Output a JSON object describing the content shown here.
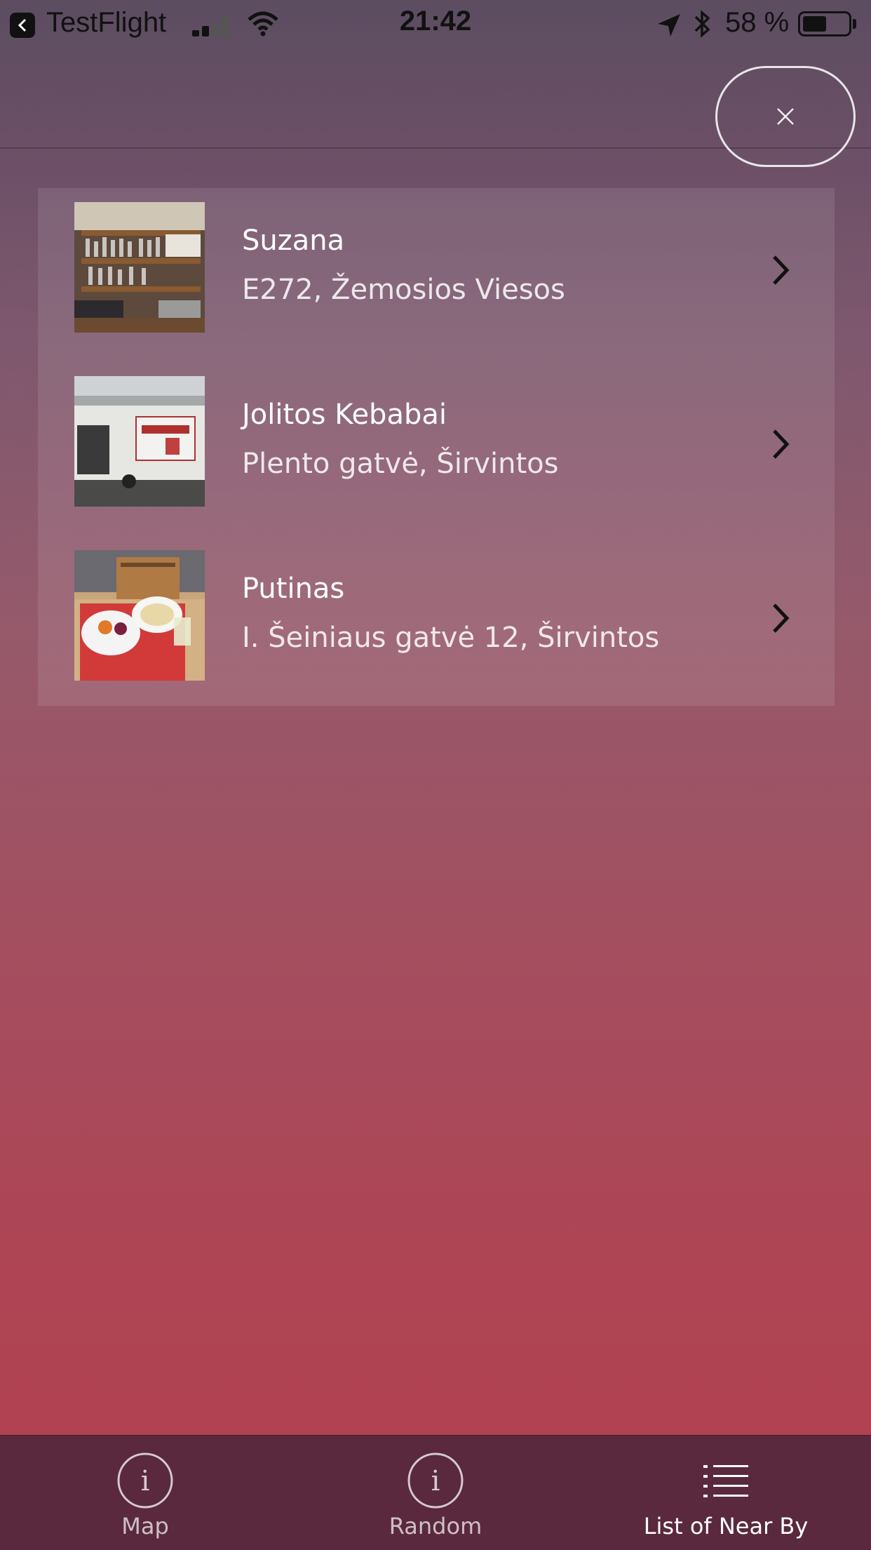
{
  "status_bar": {
    "app_name": "TestFlight",
    "time": "21:42",
    "battery_percent": "58 %",
    "battery_level": 0.58
  },
  "header": {
    "close_label": "×"
  },
  "places": [
    {
      "name": "Suzana",
      "address": "E272, Žemosios Viesos"
    },
    {
      "name": "Jolitos Kebabai",
      "address": "Plento gatvė, Širvintos"
    },
    {
      "name": "Putinas",
      "address": "I. Šeiniaus gatvė 12, Širvintos"
    }
  ],
  "tabs": [
    {
      "label": "Map",
      "icon": "info-icon",
      "active": false
    },
    {
      "label": "Random",
      "icon": "info-icon",
      "active": false
    },
    {
      "label": "List of Near By",
      "icon": "list-icon",
      "active": true
    }
  ],
  "colors": {
    "tabbar_bg": "#5a293d",
    "gradient_top": "#5c4d61",
    "gradient_bottom": "#b4404e"
  }
}
